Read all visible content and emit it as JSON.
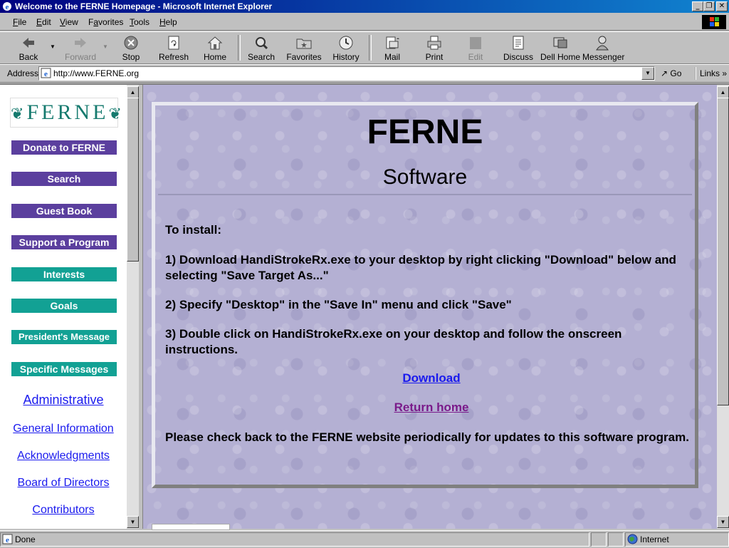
{
  "window": {
    "title": "Welcome to the FERNE Homepage - Microsoft Internet Explorer",
    "minimize": "_",
    "restore": "❐",
    "close": "✕"
  },
  "menu": [
    "File",
    "Edit",
    "View",
    "Favorites",
    "Tools",
    "Help"
  ],
  "menu_mnemonics": [
    "F",
    "E",
    "V",
    "a",
    "T",
    "H"
  ],
  "toolbar": {
    "back": "Back",
    "forward": "Forward",
    "stop": "Stop",
    "refresh": "Refresh",
    "home": "Home",
    "search": "Search",
    "favorites": "Favorites",
    "history": "History",
    "mail": "Mail",
    "print": "Print",
    "edit": "Edit",
    "discuss": "Discuss",
    "dell_home": "Dell Home",
    "messenger": "Messenger"
  },
  "address_bar": {
    "label": "Address",
    "url": "http://www.FERNE.org",
    "go": "Go",
    "links": "Links »"
  },
  "sidebar": {
    "logo_text": "FERNE",
    "buttons": [
      {
        "label": "Donate to FERNE",
        "style": "purple"
      },
      {
        "label": "Search",
        "style": "purple"
      },
      {
        "label": "Guest Book",
        "style": "purple"
      },
      {
        "label": "Support a Program",
        "style": "purple"
      },
      {
        "label": "Interests",
        "style": "teal"
      },
      {
        "label": "Goals",
        "style": "teal"
      },
      {
        "label": "President's Message",
        "style": "teal"
      },
      {
        "label": "Specific Messages",
        "style": "teal"
      }
    ],
    "links": [
      "Administrative",
      "General Information",
      "Acknowledgments",
      "Board of Directors",
      "Contributors"
    ]
  },
  "content": {
    "title": "FERNE",
    "subtitle": "Software",
    "instructions_heading": "To install:",
    "step1": "1) Download HandiStrokeRx.exe to your desktop by right clicking \"Download\" below and selecting \"Save Target As...\"",
    "step2": "2) Specify \"Desktop\" in the \"Save In\" menu and click \"Save\"",
    "step3": "3) Double click on HandiStrokeRx.exe on your desktop and follow the onscreen instructions.",
    "download_link": "Download",
    "return_link": "Return home",
    "footer_note": "Please check back to the FERNE website periodically for updates to this software program."
  },
  "status_bar": {
    "status": "Done",
    "zone": "Internet"
  },
  "colors": {
    "title_bar": "#000080",
    "nav_purple": "#5b3f9e",
    "nav_teal": "#12a194",
    "link_blue": "#1a1aee",
    "link_visited": "#7a1a8a",
    "content_bg": "#b4b0d3"
  }
}
